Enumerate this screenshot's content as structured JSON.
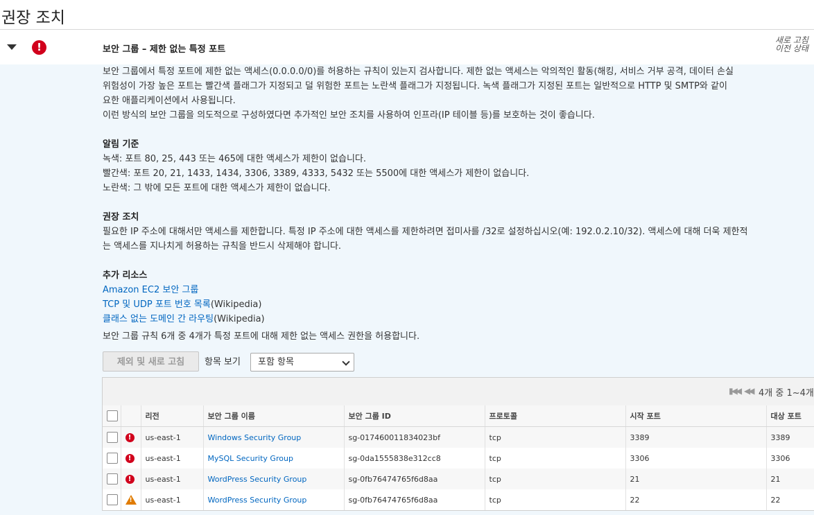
{
  "page": {
    "title": "권장 조치"
  },
  "check": {
    "title": "보안 그룹 – 제한 없는 특정 포트",
    "refresh_line1": "새로 고침",
    "refresh_line2": "이전 상태",
    "status_icon": "error-circle-icon",
    "colors": {
      "red": "#d1001c",
      "orange": "#e07b00",
      "link": "#0066c0",
      "body_bg": "#f0f7fc"
    }
  },
  "description": {
    "line1": "보안 그룹에서 특정 포트에 제한 없는 액세스(0.0.0.0/0)를 허용하는 규칙이 있는지 검사합니다. 제한 없는 액세스는 악의적인 활동(해킹, 서비스 거부 공격, 데이터 손실",
    "line2": "위험성이 가장 높은 포트는 빨간색 플래그가 지정되고 덜 위험한 포트는 노란색 플래그가 지정됩니다. 녹색 플래그가 지정된 포트는 일반적으로 HTTP 및 SMTP와 같이",
    "line3": "요한 애플리케이션에서 사용됩니다.",
    "line4": "이런 방식의 보안 그룹을 의도적으로 구성하였다면 추가적인 보안 조치를 사용하여 인프라(IP 테이블 등)를 보호하는 것이 좋습니다."
  },
  "alert_criteria": {
    "heading": "알림 기준",
    "green": "녹색: 포트 80, 25, 443 또는 465에 대한 액세스가 제한이 없습니다.",
    "red": "빨간색: 포트 20, 21, 1433, 1434, 3306, 3389, 4333, 5432 또는 5500에 대한 액세스가 제한이 없습니다.",
    "yellow": "노란색: 그 밖에 모든 포트에 대한 액세스가 제한이 없습니다."
  },
  "recommended_action": {
    "heading": "권장 조치",
    "line1": "필요한 IP 주소에 대해서만 액세스를 제한합니다. 특정 IP 주소에 대한 액세스를 제한하려면 접미사를 /32로 설정하십시오(예: 192.0.2.10/32). 액세스에 대해 더욱 제한적",
    "line2": "는 액세스를 지나치게 허용하는 규칙을 반드시 삭제해야 합니다."
  },
  "resources": {
    "heading": "추가 리소스",
    "link1": "Amazon EC2 보안 그룹",
    "link2": "TCP 및 UDP 포트 번호 목록",
    "link2_suffix": "(Wikipedia)",
    "link3": "클래스 없는 도메인 간 라우팅",
    "link3_suffix": "(Wikipedia)"
  },
  "summary": "보안 그룹 규칙 6개 중 4개가 특정 포트에 대해 제한 없는 액세스 권한을 허용합니다.",
  "toolbar": {
    "exclude_refresh_label": "제외 및 새로 고침",
    "view_label": "항목 보기",
    "view_selected": "포함 항목"
  },
  "pager": {
    "text": "4개 중 1~4개"
  },
  "table": {
    "headers": {
      "region": "리전",
      "group_name": "보안 그룹 이름",
      "group_id": "보안 그룹 ID",
      "protocol": "프로토콜",
      "from_port": "시작 포트",
      "to_port": "대상 포트"
    },
    "rows": [
      {
        "status": "error",
        "region": "us-east-1",
        "group_name": "Windows Security Group",
        "group_id": "sg-017460011834023bf",
        "protocol": "tcp",
        "from_port": "3389",
        "to_port": "3389"
      },
      {
        "status": "error",
        "region": "us-east-1",
        "group_name": "MySQL Security Group",
        "group_id": "sg-0da1555838e312cc8",
        "protocol": "tcp",
        "from_port": "3306",
        "to_port": "3306"
      },
      {
        "status": "error",
        "region": "us-east-1",
        "group_name": "WordPress Security Group",
        "group_id": "sg-0fb76474765f6d8aa",
        "protocol": "tcp",
        "from_port": "21",
        "to_port": "21"
      },
      {
        "status": "warning",
        "region": "us-east-1",
        "group_name": "WordPress Security Group",
        "group_id": "sg-0fb76474765f6d8aa",
        "protocol": "tcp",
        "from_port": "22",
        "to_port": "22"
      }
    ]
  }
}
